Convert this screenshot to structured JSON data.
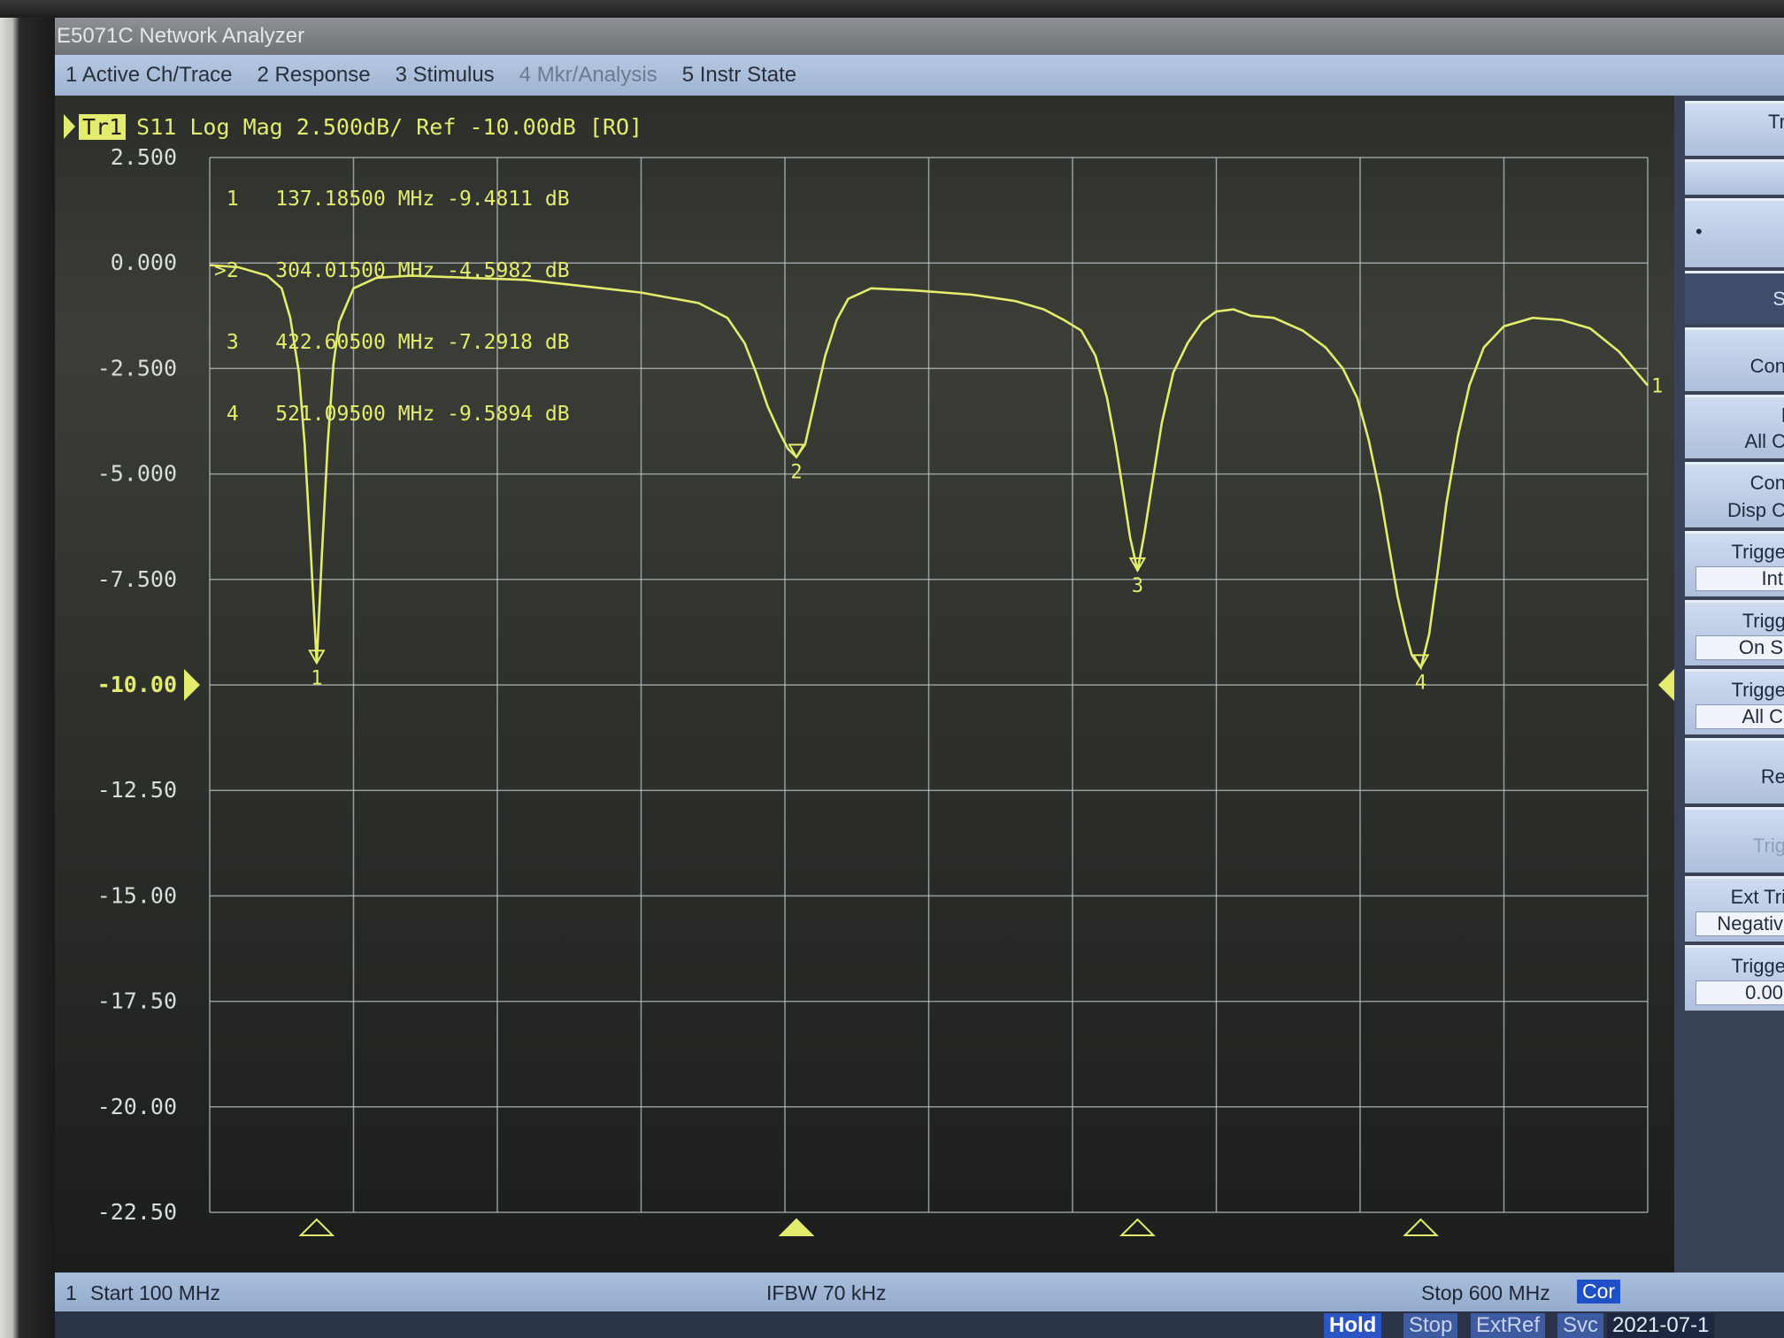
{
  "window": {
    "title": "E5071C Network Analyzer"
  },
  "menu": [
    {
      "label": "1 Active Ch/Trace"
    },
    {
      "label": "2 Response"
    },
    {
      "label": "3 Stimulus"
    },
    {
      "label": "4 Mkr/Analysis"
    },
    {
      "label": "5 Instr State"
    }
  ],
  "trace": {
    "id": "Tr1",
    "descriptor": "S11 Log Mag 2.500dB/ Ref -10.00dB [RO]"
  },
  "markers": [
    {
      "label": "1",
      "text": " 1   137.18500 MHz -9.4811 dB"
    },
    {
      "label": "2",
      "text": ">2   304.01500 MHz -4.5982 dB"
    },
    {
      "label": "3",
      "text": " 3   422.60500 MHz -7.2918 dB"
    },
    {
      "label": "4",
      "text": " 4   521.09500 MHz -9.5894 dB"
    }
  ],
  "side_panel": [
    {
      "l1": "Tr"
    },
    {
      "l1": ""
    },
    {
      "l1": "•"
    },
    {
      "l1": "S"
    },
    {
      "l1": "Con"
    },
    {
      "l1": "l",
      "l2": "All C"
    },
    {
      "l1": "Con",
      "l2": "Disp C"
    },
    {
      "l1": "Trigge",
      "l2": "Int"
    },
    {
      "l1": "Trigg",
      "l2": "On S"
    },
    {
      "l1": "Trigge",
      "l2": "All C"
    },
    {
      "l1": "Re"
    },
    {
      "l1": "Trig"
    },
    {
      "l1": "Ext Tri",
      "l2": "Negativ"
    },
    {
      "l1": "Trigge",
      "l2": "0.00"
    }
  ],
  "status": {
    "channel": "1",
    "start": "Start 100 MHz",
    "ifbw": "IFBW 70 kHz",
    "stop": "Stop 600 MHz",
    "cor": "Cor"
  },
  "bottom": {
    "hold": "Hold",
    "stop": "Stop",
    "extref": "ExtRef",
    "svc": "Svc",
    "date": "2021-07-1"
  },
  "colors": {
    "trace": "#e4ec6e",
    "grid": "#b8c4c6",
    "background": "#2d2f2b"
  },
  "chart_data": {
    "type": "line",
    "title": "S11 Log Mag 2.500dB/ Ref -10.00dB [RO]",
    "xlabel": "",
    "ylabel": "",
    "x_unit": "MHz",
    "y_unit": "dB",
    "xlim": [
      100,
      600
    ],
    "ylim": [
      -22.5,
      2.5
    ],
    "y_ticks": [
      "2.500",
      "0.000",
      "-2.500",
      "-5.000",
      "-7.500",
      "-10.00",
      "-12.50",
      "-15.00",
      "-17.50",
      "-20.00",
      "-22.50"
    ],
    "reference_level": -10.0,
    "grid": true,
    "series": [
      {
        "name": "S11",
        "x": [
          100,
          110,
          120,
          125,
          128,
          131,
          133,
          135,
          137.185,
          139,
          141,
          143,
          145,
          150,
          158,
          170,
          190,
          210,
          230,
          250,
          270,
          280,
          286,
          290,
          294,
          298,
          301,
          304.015,
          307,
          310,
          314,
          318,
          322,
          330,
          345,
          365,
          380,
          390,
          397,
          403,
          408,
          412,
          415,
          418,
          420,
          422.605,
          425,
          428,
          431,
          435,
          440,
          445,
          450,
          456,
          462,
          470,
          480,
          488,
          494,
          499,
          503,
          507,
          510,
          513,
          516,
          518,
          521.095,
          524,
          527,
          530,
          534,
          538,
          543,
          550,
          560,
          570,
          580,
          590,
          600
        ],
        "y": [
          -0.05,
          -0.1,
          -0.3,
          -0.6,
          -1.3,
          -2.6,
          -4.3,
          -6.7,
          -9.48,
          -6.9,
          -4.3,
          -2.4,
          -1.4,
          -0.6,
          -0.35,
          -0.3,
          -0.35,
          -0.4,
          -0.55,
          -0.7,
          -0.95,
          -1.3,
          -1.9,
          -2.6,
          -3.4,
          -4.0,
          -4.4,
          -4.6,
          -4.3,
          -3.4,
          -2.2,
          -1.35,
          -0.85,
          -0.6,
          -0.65,
          -0.75,
          -0.9,
          -1.1,
          -1.35,
          -1.6,
          -2.2,
          -3.2,
          -4.3,
          -5.6,
          -6.5,
          -7.29,
          -6.4,
          -5.1,
          -3.8,
          -2.6,
          -1.9,
          -1.4,
          -1.15,
          -1.1,
          -1.25,
          -1.3,
          -1.6,
          -2.0,
          -2.5,
          -3.2,
          -4.2,
          -5.5,
          -6.7,
          -7.9,
          -8.8,
          -9.3,
          -9.59,
          -8.8,
          -7.3,
          -5.7,
          -4.1,
          -2.9,
          -2.0,
          -1.5,
          -1.3,
          -1.35,
          -1.55,
          -2.1,
          -2.9
        ]
      }
    ],
    "markers": [
      {
        "id": "1",
        "x": 137.185,
        "y": -9.4811
      },
      {
        "id": "2",
        "x": 304.015,
        "y": -4.5982
      },
      {
        "id": "3",
        "x": 422.605,
        "y": -7.2918
      },
      {
        "id": "4",
        "x": 521.095,
        "y": -9.5894
      }
    ]
  }
}
